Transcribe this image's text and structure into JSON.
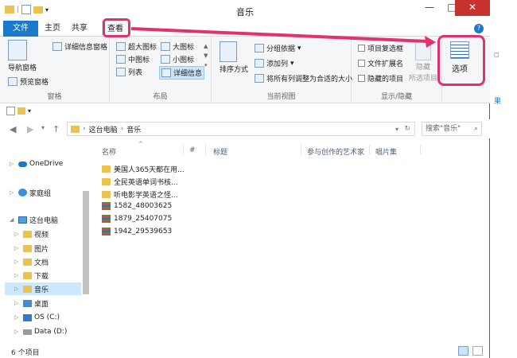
{
  "window": {
    "title": "音乐"
  },
  "tabs": [
    {
      "label": "文件"
    },
    {
      "label": "主页"
    },
    {
      "label": "共享"
    },
    {
      "label": "查看"
    }
  ],
  "ribbon": {
    "panes": {
      "nav_pane": "导航窗格",
      "preview_pane": "预览窗格",
      "details_pane": "详细信息窗格",
      "group": "窗格"
    },
    "layout": {
      "extra_large": "超大图标",
      "large": "大图标",
      "medium": "中图标",
      "small": "小图标",
      "list": "列表",
      "details": "详细信息",
      "group": "布局"
    },
    "current_view": {
      "sort_by": "排序方式",
      "group_by": "分组依据",
      "add_columns": "添加列",
      "size_all": "将所有列调整为合适的大小",
      "group": "当前视图"
    },
    "show_hide": {
      "item_checkboxes": "项目复选框",
      "file_extensions": "文件扩展名",
      "hidden_items": "隐藏的项目",
      "hide": "隐藏",
      "hide_selected": "所选项目",
      "group": "显示/隐藏"
    },
    "options": "选项"
  },
  "address": {
    "this_pc": "这台电脑",
    "music": "音乐",
    "search_placeholder": "搜索\"音乐\""
  },
  "nav": [
    {
      "label": "OneDrive"
    },
    {
      "label": "家庭组"
    },
    {
      "label": "这台电脑"
    },
    {
      "label": "视频"
    },
    {
      "label": "图片"
    },
    {
      "label": "文档"
    },
    {
      "label": "下载"
    },
    {
      "label": "音乐"
    },
    {
      "label": "桌面"
    },
    {
      "label": "OS (C:)"
    },
    {
      "label": "Data (D:)"
    }
  ],
  "columns": {
    "name": "名称",
    "num": "#",
    "title": "标题",
    "artist": "参与创作的艺术家",
    "album": "唱片集"
  },
  "files": [
    {
      "name": "美国人365天都在用..."
    },
    {
      "name": "全民英语单词书核..."
    },
    {
      "name": "听电影学英语之怪..."
    },
    {
      "name": "1582_48003625"
    },
    {
      "name": "1879_25407075"
    },
    {
      "name": "1942_29539653"
    }
  ],
  "status": {
    "count": "6 个项目"
  },
  "side_partial": {
    "text": "果"
  },
  "colors": {
    "accent": "#1979ca",
    "highlight": "#e0336e",
    "folder": "#e9c24f"
  }
}
